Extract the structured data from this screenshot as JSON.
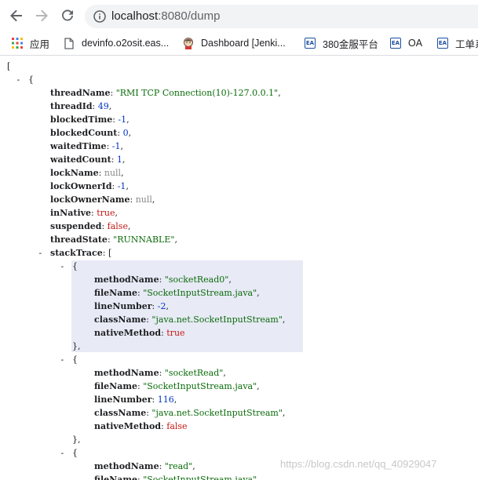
{
  "browser": {
    "url_host": "localhost",
    "url_rest": ":8080/dump"
  },
  "bookmarks": [
    {
      "label": "应用",
      "icon": "apps-grid-icon"
    },
    {
      "label": "devinfo.o2osit.eas...",
      "icon": "page-icon"
    },
    {
      "label": "Dashboard [Jenki...",
      "icon": "jenkins-icon"
    },
    {
      "label": "380金服平台",
      "icon": "ea-logo-icon"
    },
    {
      "label": "OA",
      "icon": "ea-logo-icon"
    },
    {
      "label": "工单系",
      "icon": "ea-logo-icon"
    }
  ],
  "icons": {
    "ea_text": "EA"
  },
  "json": {
    "open_array": "[",
    "open_object": "{",
    "close_object": "},",
    "collapse_glyph": "-",
    "thread": [
      {
        "key": "threadName",
        "value": "\"RMI TCP Connection(10)-127.0.0.1\"",
        "type": "str"
      },
      {
        "key": "threadId",
        "value": "49",
        "type": "num"
      },
      {
        "key": "blockedTime",
        "value": "-1",
        "type": "num"
      },
      {
        "key": "blockedCount",
        "value": "0",
        "type": "num"
      },
      {
        "key": "waitedTime",
        "value": "-1",
        "type": "num"
      },
      {
        "key": "waitedCount",
        "value": "1",
        "type": "num"
      },
      {
        "key": "lockName",
        "value": "null",
        "type": "nul"
      },
      {
        "key": "lockOwnerId",
        "value": "-1",
        "type": "num"
      },
      {
        "key": "lockOwnerName",
        "value": "null",
        "type": "nul"
      },
      {
        "key": "inNative",
        "value": "true",
        "type": "bool"
      },
      {
        "key": "suspended",
        "value": "false",
        "type": "bool"
      },
      {
        "key": "threadState",
        "value": "\"RUNNABLE\"",
        "type": "str"
      }
    ],
    "stack_trace_key": "stackTrace",
    "stack_trace_open": "[",
    "frames": [
      [
        {
          "key": "methodName",
          "value": "\"socketRead0\"",
          "type": "str"
        },
        {
          "key": "fileName",
          "value": "\"SocketInputStream.java\"",
          "type": "str"
        },
        {
          "key": "lineNumber",
          "value": "-2",
          "type": "num"
        },
        {
          "key": "className",
          "value": "\"java.net.SocketInputStream\"",
          "type": "str"
        },
        {
          "key": "nativeMethod",
          "value": "true",
          "type": "bool"
        }
      ],
      [
        {
          "key": "methodName",
          "value": "\"socketRead\"",
          "type": "str"
        },
        {
          "key": "fileName",
          "value": "\"SocketInputStream.java\"",
          "type": "str"
        },
        {
          "key": "lineNumber",
          "value": "116",
          "type": "num"
        },
        {
          "key": "className",
          "value": "\"java.net.SocketInputStream\"",
          "type": "str"
        },
        {
          "key": "nativeMethod",
          "value": "false",
          "type": "bool"
        }
      ],
      [
        {
          "key": "methodName",
          "value": "\"read\"",
          "type": "str"
        },
        {
          "key": "fileName",
          "value": "\"SocketInputStream.java\"",
          "type": "str"
        }
      ]
    ]
  },
  "watermark": "https://blog.csdn.net/qq_40929047"
}
